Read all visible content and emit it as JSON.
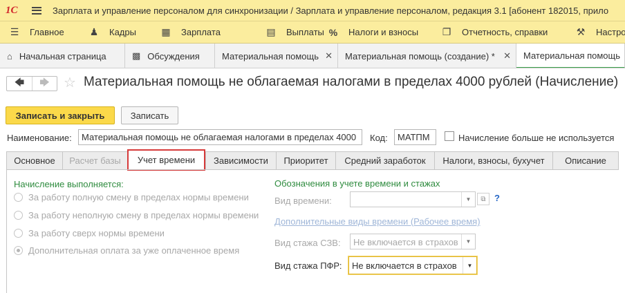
{
  "titlebar": {
    "logo": "1С",
    "title": "Зарплата и управление персоналом для синхронизации / Зарплата и управление персоналом, редакция 3.1 [абонент 182015, прило"
  },
  "menu": {
    "items": [
      {
        "label": "Главное",
        "icon": "menu-icon"
      },
      {
        "label": "Кадры",
        "icon": "people-icon"
      },
      {
        "label": "Зарплата",
        "icon": "calculator-icon"
      },
      {
        "label": "Выплаты",
        "icon": "money-icon"
      },
      {
        "label": "Налоги и взносы",
        "icon": "percent-icon"
      },
      {
        "label": "Отчетность, справки",
        "icon": "report-icon"
      },
      {
        "label": "Настро",
        "icon": "wrench-icon"
      }
    ]
  },
  "open_tabs": [
    {
      "label": "Начальная страница",
      "icon": "home-icon",
      "closable": false
    },
    {
      "label": "Обсуждения",
      "icon": "chat-icon",
      "closable": false
    },
    {
      "label": "Материальная помощь",
      "closable": true
    },
    {
      "label": "Материальная помощь (создание) *",
      "closable": true
    },
    {
      "label": "Материальная помощь",
      "closable": false,
      "active": true
    }
  ],
  "document": {
    "title": "Материальная помощь не облагаемая налогами в пределах 4000 рублей (Начисление)"
  },
  "toolbar": {
    "save_close_label": "Записать и закрыть",
    "save_label": "Записать"
  },
  "header_fields": {
    "name_label": "Наименование:",
    "name_value": "Материальная помощь не облагаемая налогами в пределах 4000",
    "code_label": "Код:",
    "code_value": "МАТПМ",
    "unused_label": "Начисление больше не используется"
  },
  "form_tabs": [
    {
      "label": "Основное"
    },
    {
      "label": "Расчет базы",
      "disabled": true
    },
    {
      "label": "Учет времени",
      "active": true
    },
    {
      "label": "Зависимости"
    },
    {
      "label": "Приоритет"
    },
    {
      "label": "Средний заработок"
    },
    {
      "label": "Налоги, взносы, бухучет"
    },
    {
      "label": "Описание"
    }
  ],
  "time_tab": {
    "accrual_header": "Начисление выполняется:",
    "options": [
      {
        "label": "За работу полную смену в пределах нормы времени"
      },
      {
        "label": "За работу неполную смену в пределах нормы времени"
      },
      {
        "label": "За работу сверх нормы времени"
      },
      {
        "label": "Дополнительная оплата за уже оплаченное время",
        "checked": true
      }
    ],
    "designations_header": "Обозначения в учете времени и стажах",
    "time_type_label": "Вид времени:",
    "time_type_value": "",
    "help": "?",
    "extra_time_link": "Дополнительные виды времени (Рабочее время)",
    "szv_label": "Вид стажа СЗВ:",
    "szv_value": "Не включается в страхов",
    "pfr_label": "Вид стажа ПФР:",
    "pfr_value": "Не включается в страхов"
  }
}
